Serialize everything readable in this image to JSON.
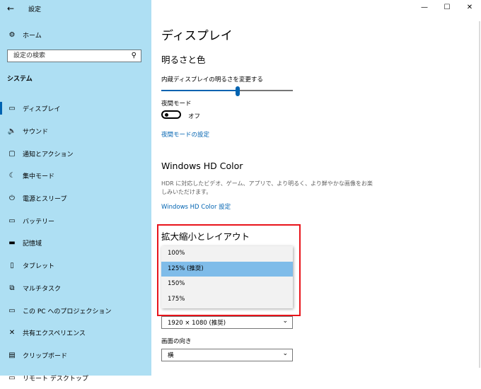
{
  "window": {
    "title": "設定",
    "back_icon": "back-arrow-icon",
    "controls": [
      "—",
      "☐",
      "✕"
    ]
  },
  "sidebar": {
    "home_label": "ホーム",
    "search_placeholder": "設定の検索",
    "section_label": "システム",
    "items": [
      {
        "label": "ディスプレイ",
        "icon": "monitor-icon",
        "glyph": "▭",
        "active": true
      },
      {
        "label": "サウンド",
        "icon": "speaker-icon",
        "glyph": "🔈",
        "active": false
      },
      {
        "label": "通知とアクション",
        "icon": "message-icon",
        "glyph": "▢",
        "active": false
      },
      {
        "label": "集中モード",
        "icon": "moon-icon",
        "glyph": "☾",
        "active": false
      },
      {
        "label": "電源とスリープ",
        "icon": "power-icon",
        "glyph": "⏻",
        "active": false
      },
      {
        "label": "バッテリー",
        "icon": "battery-icon",
        "glyph": "▭",
        "active": false
      },
      {
        "label": "記憶域",
        "icon": "storage-icon",
        "glyph": "▬",
        "active": false
      },
      {
        "label": "タブレット",
        "icon": "tablet-icon",
        "glyph": "▯",
        "active": false
      },
      {
        "label": "マルチタスク",
        "icon": "multitask-icon",
        "glyph": "⧉",
        "active": false
      },
      {
        "label": "この PC へのプロジェクション",
        "icon": "projection-icon",
        "glyph": "▭",
        "active": false
      },
      {
        "label": "共有エクスペリエンス",
        "icon": "share-icon",
        "glyph": "✕",
        "active": false
      },
      {
        "label": "クリップボード",
        "icon": "clipboard-icon",
        "glyph": "▤",
        "active": false
      },
      {
        "label": "リモート デスクトップ",
        "icon": "remote-desktop-icon",
        "glyph": "▭",
        "active": false
      }
    ]
  },
  "main": {
    "title": "ディスプレイ",
    "brightness": {
      "heading": "明るさと色",
      "slider_label": "内蔵ディスプレイの明るさを変更する",
      "value": 0.58
    },
    "night_light": {
      "label": "夜間モード",
      "state": "オフ",
      "settings_link": "夜間モードの設定"
    },
    "hdr": {
      "heading": "Windows HD Color",
      "description": "HDR に対応したビデオ、ゲーム、アプリで、より明るく、より鮮やかな画像をお楽しみいただけます。",
      "link": "Windows HD Color 設定"
    },
    "scale": {
      "heading": "拡大縮小とレイアウト",
      "options": [
        "100%",
        "125% (推奨)",
        "150%",
        "175%"
      ],
      "selected_index": 1
    },
    "resolution": {
      "value": "1920 × 1080 (推奨)"
    },
    "orientation": {
      "label": "画面の向き",
      "value": "横"
    }
  },
  "colors": {
    "sidebar_bg": "#aedff3",
    "accent": "#0063b1",
    "highlight": "#e8141b",
    "selected": "#7fbce9"
  }
}
